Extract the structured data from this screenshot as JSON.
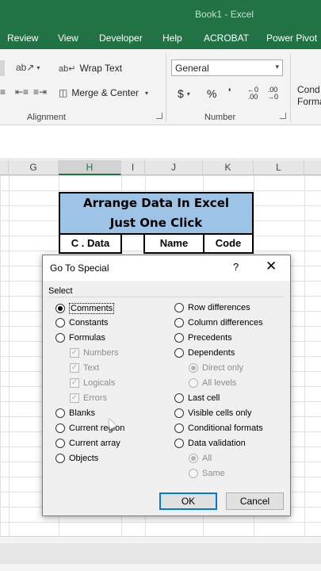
{
  "window": {
    "title": "Book1  -  Excel"
  },
  "ribbon_tabs": [
    "Review",
    "View",
    "Developer",
    "Help",
    "ACROBAT",
    "Power Pivot"
  ],
  "ribbon": {
    "wrap_text": "Wrap Text",
    "merge_center": "Merge & Center",
    "number_format": "General",
    "currency": "$",
    "percent": "%",
    "comma": "'",
    "increase_decimal": ".00",
    "decrease_decimal": ".00",
    "cond_line1": "Cond",
    "cond_line2": "Forma",
    "group_alignment": "Alignment",
    "group_number": "Number"
  },
  "columns": [
    "G",
    "H",
    "I",
    "J",
    "K",
    "L"
  ],
  "sheet": {
    "banner_line1": "Arrange Data In Excel",
    "banner_line2": "Just One Click",
    "headers": [
      "C . Data",
      "Name",
      "Code"
    ]
  },
  "dialog": {
    "title": "Go To Special",
    "help": "?",
    "close": "✕",
    "select_label": "Select",
    "left_options": [
      "Comments",
      "Constants",
      "Formulas",
      "Numbers",
      "Text",
      "Logicals",
      "Errors",
      "Blanks",
      "Current region",
      "Current array",
      "Objects"
    ],
    "right_options": [
      "Row differences",
      "Column differences",
      "Precedents",
      "Dependents",
      "Direct only",
      "All levels",
      "Last cell",
      "Visible cells only",
      "Conditional formats",
      "Data validation",
      "All",
      "Same"
    ],
    "selected": "Comments",
    "ok_label": "OK",
    "cancel_label": "Cancel"
  },
  "colors": {
    "excel_green": "#217346",
    "banner_blue": "#9dc3e6",
    "focus_blue": "#0078d7"
  }
}
